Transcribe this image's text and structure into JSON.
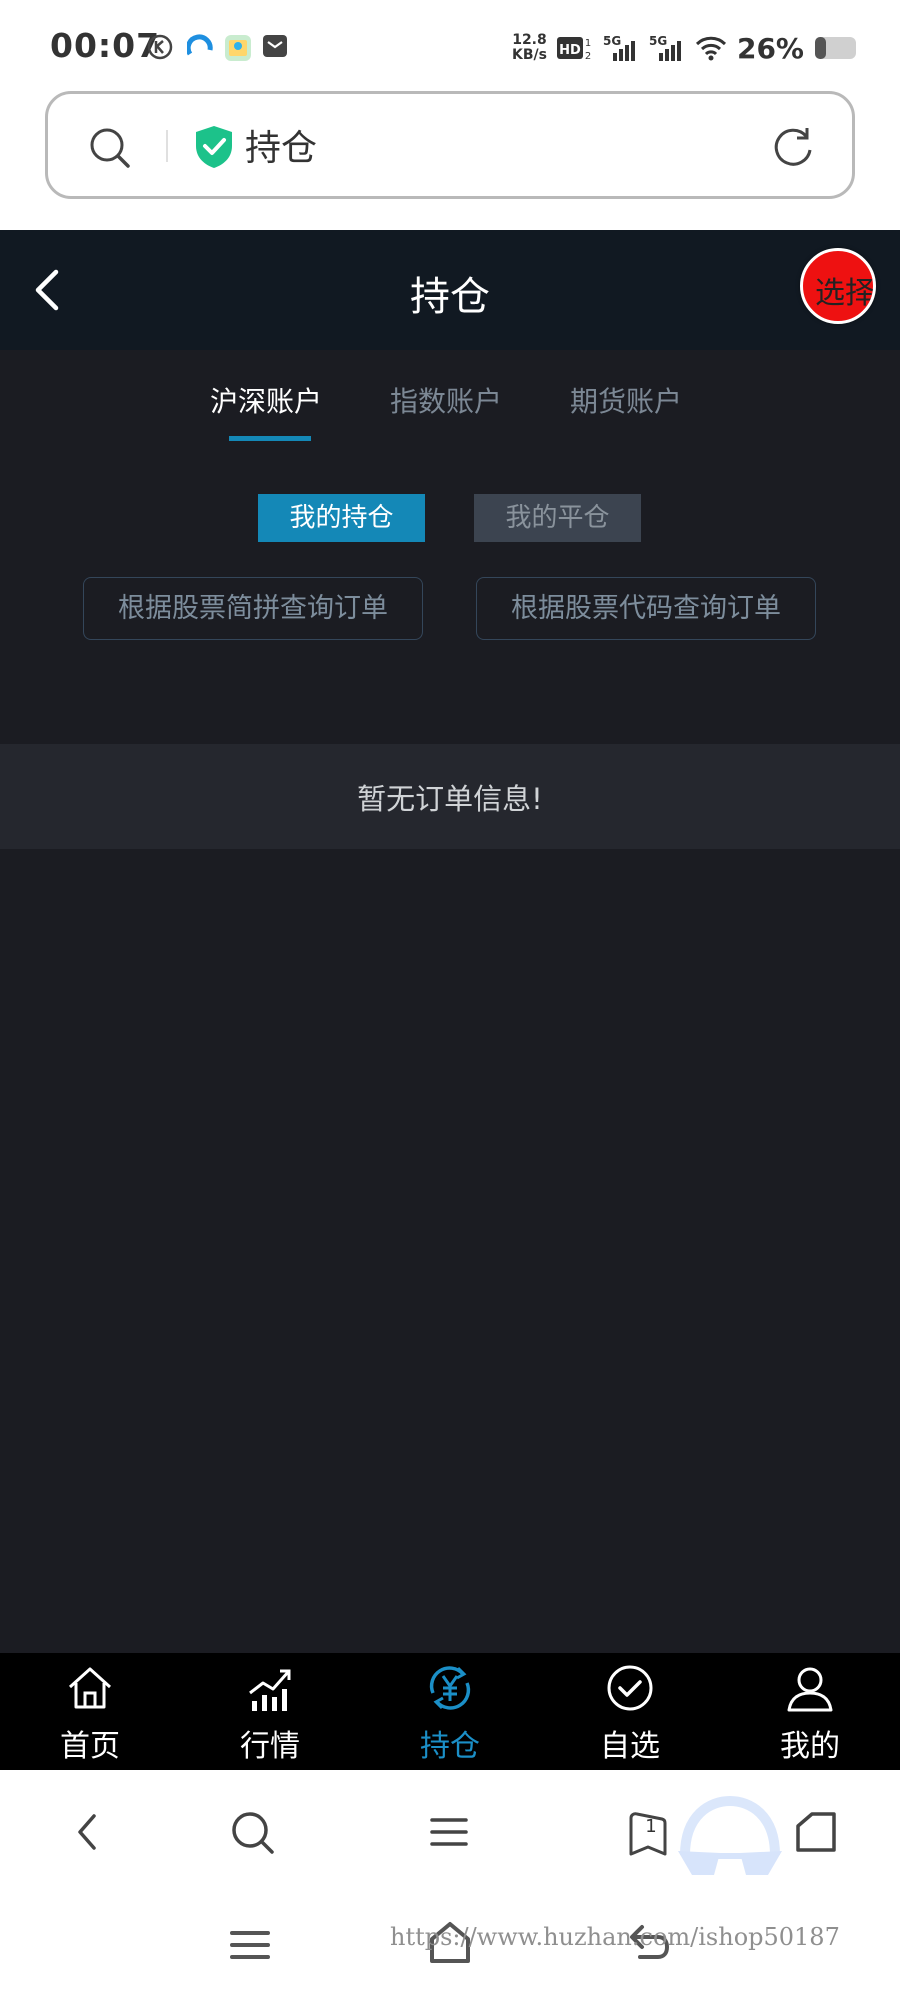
{
  "status_bar": {
    "time": "00:07",
    "net_speed_value": "12.8",
    "net_speed_unit": "KB/s",
    "signal_labels": [
      "HD",
      "5G",
      "5G"
    ],
    "battery_percent": "26%"
  },
  "address_bar": {
    "text": "持仓"
  },
  "header": {
    "title": "持仓",
    "float_badge": "选择语"
  },
  "account_tabs": [
    {
      "label": "沪深账户",
      "active": true
    },
    {
      "label": "指数账户",
      "active": false
    },
    {
      "label": "期货账户",
      "active": false
    }
  ],
  "position_toggle": {
    "holdings_label": "我的持仓",
    "closed_label": "我的平仓"
  },
  "query_buttons": {
    "by_pinyin": "根据股票简拼查询订单",
    "by_code": "根据股票代码查询订单"
  },
  "empty_message": "暂无订单信息!",
  "bottom_nav": [
    {
      "label": "首页",
      "icon": "home-icon",
      "active": false
    },
    {
      "label": "行情",
      "icon": "chart-icon",
      "active": false
    },
    {
      "label": "持仓",
      "icon": "yuan-icon",
      "active": true
    },
    {
      "label": "自选",
      "icon": "checkmark-icon",
      "active": false
    },
    {
      "label": "我的",
      "icon": "user-icon",
      "active": false
    }
  ],
  "browser_toolbar": {
    "tab_count": "1"
  },
  "watermark": "https://www.huzhan.com/ishop50187",
  "colors": {
    "accent": "#1488b7",
    "header_bg": "#111922",
    "main_bg": "#1b1c22",
    "nav_bg": "#000000",
    "secure_green": "#1cc28a",
    "badge_red": "#ee1111"
  }
}
